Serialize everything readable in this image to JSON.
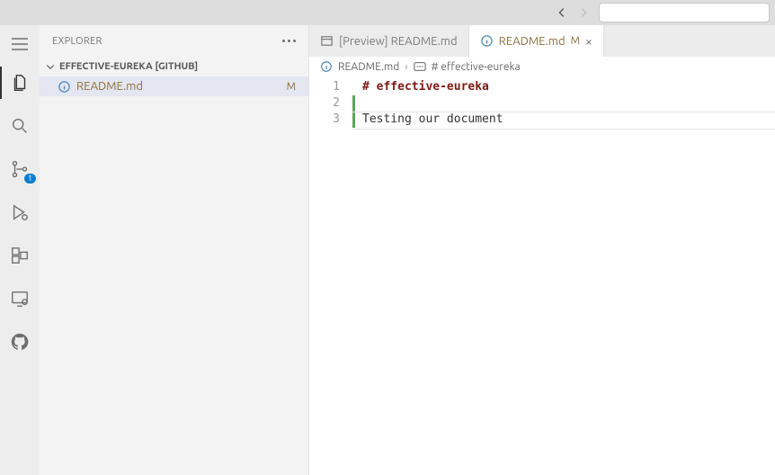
{
  "sidebar": {
    "title": "EXPLORER",
    "section": "EFFECTIVE-EUREKA [GITHUB]",
    "file": {
      "name": "README.md",
      "status": "M"
    }
  },
  "tabs": {
    "preview": {
      "label": "[Preview] README.md"
    },
    "editor": {
      "label": "README.md",
      "status": "M"
    }
  },
  "breadcrumb": {
    "file": "README.md",
    "heading": "# effective-eureka"
  },
  "editor": {
    "l1_num": "1",
    "l1_text": "# effective-eureka",
    "l2_num": "2",
    "l2_text": "",
    "l3_num": "3",
    "l3_text": "Testing our document"
  },
  "scm_badge": "1"
}
